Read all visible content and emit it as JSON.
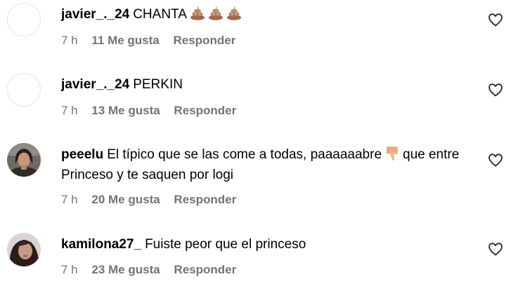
{
  "comments": [
    {
      "username": "javier_._24",
      "text": "CHANTA",
      "time": "7 h",
      "likes": "11 Me gusta",
      "reply": "Responder",
      "emoji": [
        "pile-of-poo-emoji",
        "pile-of-poo-emoji",
        "pile-of-poo-emoji"
      ],
      "avatar": "empty"
    },
    {
      "username": "javier_._24",
      "text": "PERKIN",
      "time": "7 h",
      "likes": "13 Me gusta",
      "reply": "Responder",
      "avatar": "empty"
    },
    {
      "username": "peeelu",
      "text_before_emoji": "El típico que se las come a todas, paaaaaabre",
      "emoji": "thumbs-down-emoji",
      "text_after_emoji": "que entre Princeso y te saquen por logi",
      "time": "7 h",
      "likes": "20 Me gusta",
      "reply": "Responder",
      "avatar": "photo"
    },
    {
      "username": "kamilona27_",
      "text": "Fuiste peor que el princeso",
      "time": "7 h",
      "likes": "23 Me gusta",
      "reply": "Responder",
      "avatar": "photo"
    }
  ],
  "icons": {
    "like": "heart-outline-icon"
  },
  "colors": {
    "meta_text": "#737373",
    "text": "#000000",
    "background": "#ffffff"
  }
}
